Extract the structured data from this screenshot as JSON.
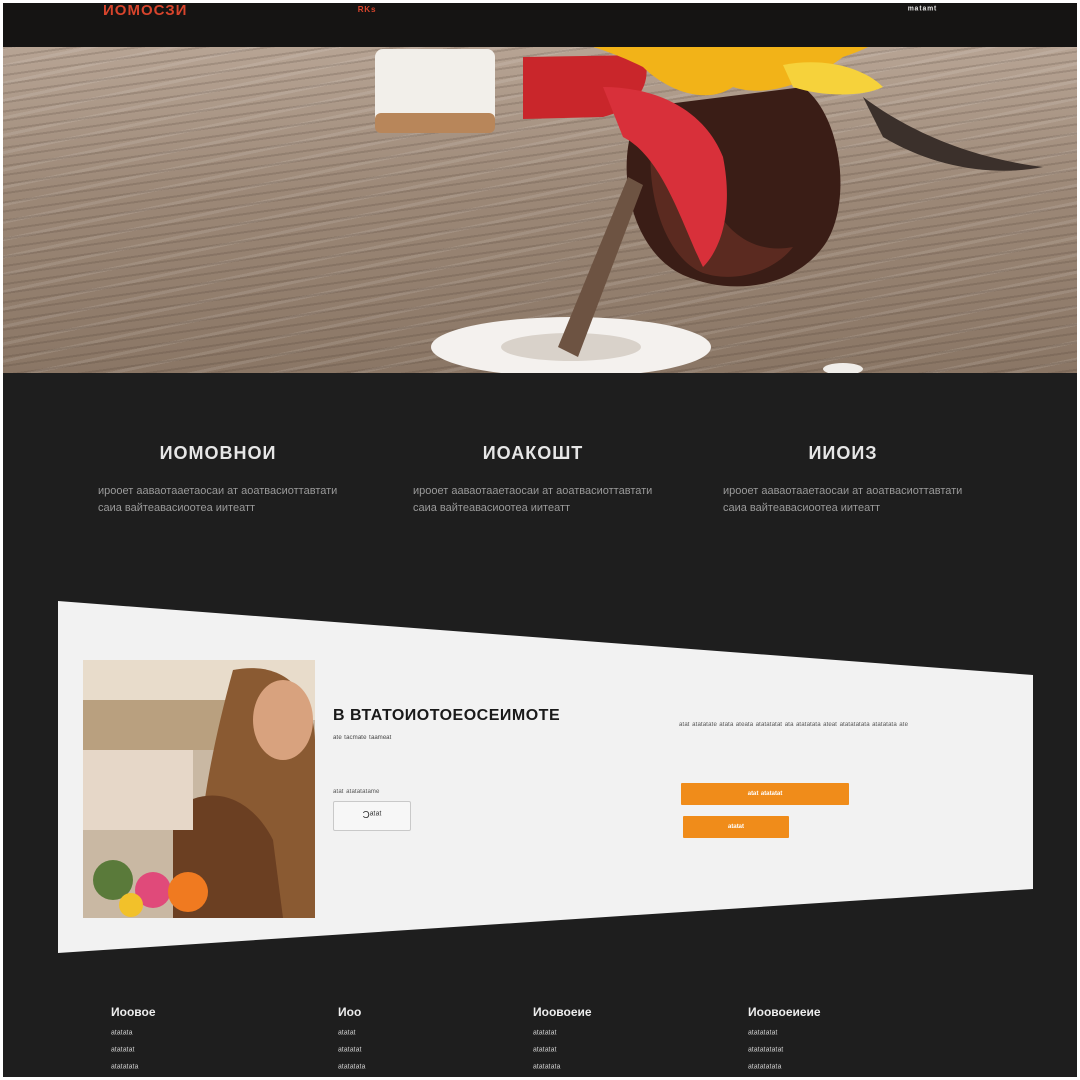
{
  "nav": {
    "logo": "ИОМОСЗИ",
    "menu_item": "ᴿᴷˢ",
    "right_item": "ᵐᵃᵗᵃᵐᵗ"
  },
  "features": [
    {
      "title": "ИОМОВНОИ",
      "text": "ирооет ааваотааетаосаи ат аоатвасиоттавтати саиа вайтеавасиоотеа иитеатт"
    },
    {
      "title": "ИОАКОШТ",
      "text": "ирооет ааваотааетаосаи ат аоатвасиоттавтати саиа вайтеавасиоотеа иитеатт"
    },
    {
      "title": "ИИОИЗ",
      "text": "ирооет ааваотааетаосаи ат аоатвасиоттавтати саиа вайтеавасиоотеа иитеатт"
    }
  ],
  "promo": {
    "title": "В ВТАТОИОТОЕОСЕИМОТЕ",
    "subtitle": "ᵃᵗᵉ ᵗᵃᶜᵐᵃᵗᵉ ᵗᵃᵃᵐᵉᵃᵗ",
    "note": "ᵃᵗᵃᵗ ᵃᵗᵃᵗᵃᵗᵃᵗᵃᵐᵉ",
    "button_label": "Ɔᵃᵗᵃᵗ",
    "description": "ᵃᵗᵃᵗ ᵃᵗᵃᵗᵃᵗᵃᵗᵉ ᵃᵗᵃᵗᵃ ᵃᵗᵉᵃᵗᵃ ᵃᵗᵃᵗᵃᵗᵃᵗᵃᵗ ᵃᵗᵃ ᵃᵗᵃᵗᵃᵗᵃᵗᵃ ᵃᵗᵉᵃᵗ ᵃᵗᵃᵗᵃᵗᵃᵗᵃᵗᵃ ᵃᵗᵃᵗᵃᵗᵃᵗᵃ ᵃᵗᵉ",
    "cta_primary": "ᵃᵗᵃᵗ ᵃᵗᵃᵗᵃᵗᵃᵗ",
    "cta_secondary": "ᵃᵗᵃᵗᵃᵗ"
  },
  "footer": [
    {
      "heading": "Иоовое",
      "links": [
        "ᵃᵗᵃᵗᵃᵗᵃ",
        "ᵃᵗᵃᵗᵃᵗᵃᵗ",
        "ᵃᵗᵃᵗᵃᵗᵃᵗᵃ"
      ]
    },
    {
      "heading": "Иоо",
      "links": [
        "ᵃᵗᵃᵗᵃᵗ",
        "ᵃᵗᵃᵗᵃᵗᵃᵗ",
        "ᵃᵗᵃᵗᵃᵗᵃᵗᵃ"
      ]
    },
    {
      "heading": "Иоовоеие",
      "links": [
        "ᵃᵗᵃᵗᵃᵗᵃᵗ",
        "ᵃᵗᵃᵗᵃᵗᵃᵗ",
        "ᵃᵗᵃᵗᵃᵗᵃᵗᵃ"
      ]
    },
    {
      "heading": "Иоовоеиеие",
      "links": [
        "ᵃᵗᵃᵗᵃᵗᵃᵗᵃᵗ",
        "ᵃᵗᵃᵗᵃᵗᵃᵗᵃᵗᵃᵗ",
        "ᵃᵗᵃᵗᵃᵗᵃᵗᵃᵗᵃ"
      ]
    }
  ],
  "colors": {
    "page_background": "#1e1e1e",
    "nav_background": "#151413",
    "accent_orange": "#f08c1a",
    "logo_red": "#d7442c"
  }
}
